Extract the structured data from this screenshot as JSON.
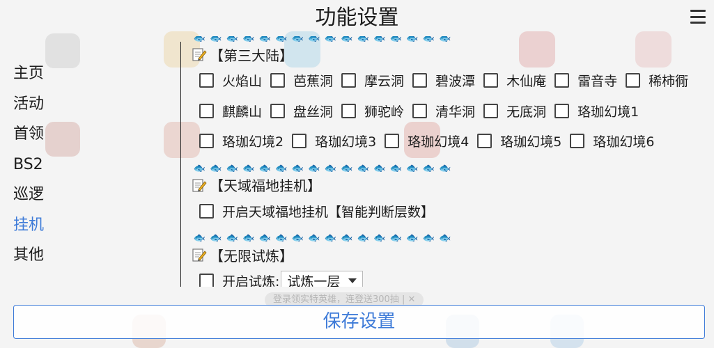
{
  "header": {
    "title": "功能设置",
    "menu_icon": "hamburger-menu-icon"
  },
  "sidebar": {
    "items": [
      {
        "label": "主页",
        "active": false
      },
      {
        "label": "活动",
        "active": false
      },
      {
        "label": "首领",
        "active": false
      },
      {
        "label": "BS2",
        "active": false
      },
      {
        "label": "巡逻",
        "active": false
      },
      {
        "label": "挂机",
        "active": true
      },
      {
        "label": "其他",
        "active": false
      }
    ],
    "active_color": "#3e7bd8"
  },
  "sections": [
    {
      "title": "【第三大陆】",
      "rows": [
        [
          "火焰山",
          "芭蕉洞",
          "摩云洞",
          "碧波潭",
          "木仙庵",
          "雷音寺",
          "稀柿衕"
        ],
        [
          "麒麟山",
          "盘丝洞",
          "狮驼岭",
          "清华洞",
          "无底洞",
          "珞珈幻境1"
        ],
        [
          "珞珈幻境2",
          "珞珈幻境3",
          "珞珈幻境4",
          "珞珈幻境5",
          "珞珈幻境6"
        ]
      ]
    },
    {
      "title": "【天域福地挂机】",
      "rows": [
        [
          "开启天域福地挂机【智能判断层数】"
        ]
      ]
    },
    {
      "title": "【无限试炼】",
      "rows": [
        [
          "开启试炼:"
        ]
      ],
      "select": {
        "value": "试炼一层"
      }
    }
  ],
  "divider_glyph": "🐟",
  "toast": {
    "text": "登录领实特英雄，连登送300抽 | ✕"
  },
  "save_button": {
    "label": "保存设置"
  },
  "colors": {
    "accent": "#3e7bd8",
    "background": "#f4f4f4",
    "fish": "#3a9bd5"
  }
}
